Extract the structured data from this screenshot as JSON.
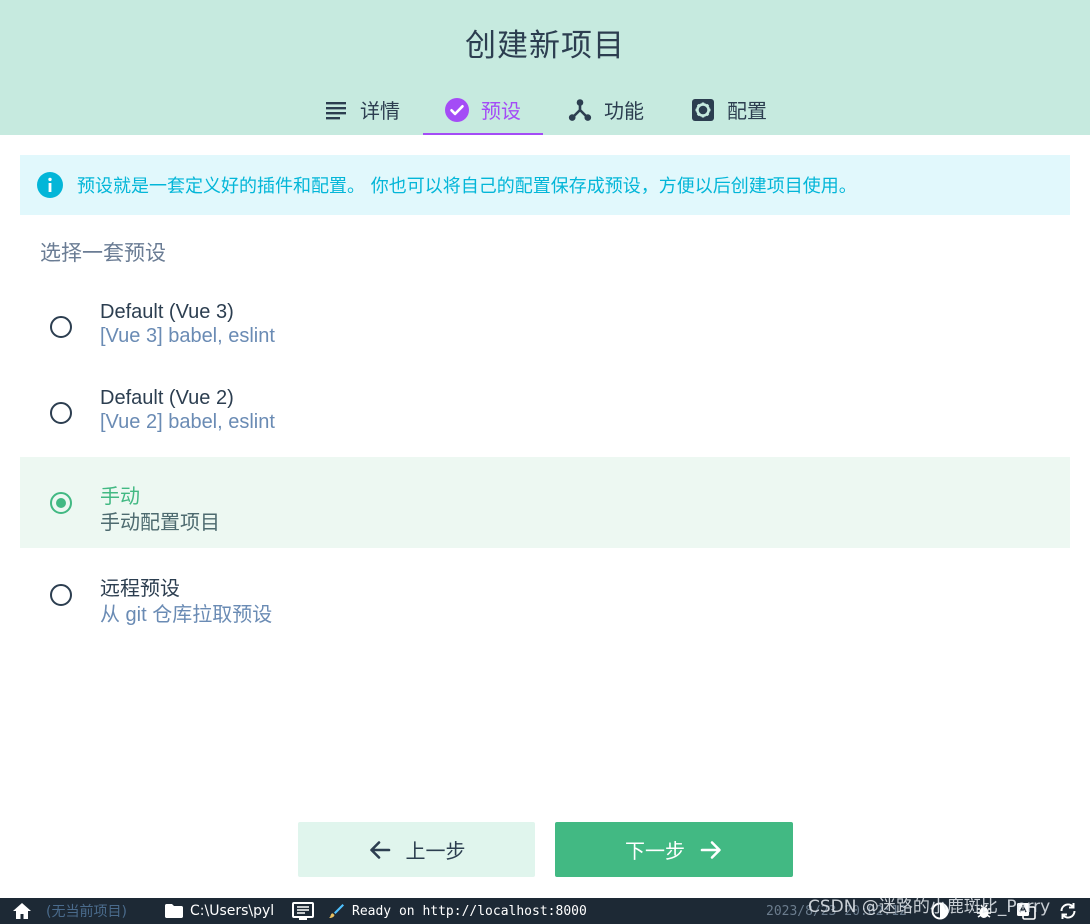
{
  "header": {
    "title": "创建新项目",
    "tabs": [
      {
        "label": "详情",
        "icon": "list-icon",
        "active": false
      },
      {
        "label": "预设",
        "icon": "check-circle-icon",
        "active": true
      },
      {
        "label": "功能",
        "icon": "fork-icon",
        "active": false
      },
      {
        "label": "配置",
        "icon": "gear-icon",
        "active": false
      }
    ]
  },
  "info": {
    "icon": "info-icon",
    "text": "预设就是一套定义好的插件和配置。 你也可以将自己的配置保存成预设，方便以后创建项目使用。"
  },
  "presets": {
    "section_title": "选择一套预设",
    "options": [
      {
        "name": "Default (Vue 3)",
        "desc": "[Vue 3] babel, eslint",
        "selected": false
      },
      {
        "name": "Default (Vue 2)",
        "desc": "[Vue 2] babel, eslint",
        "selected": false
      },
      {
        "name": "手动",
        "desc": "手动配置项目",
        "selected": true
      },
      {
        "name": "远程预设",
        "desc": "从 git 仓库拉取预设",
        "selected": false
      }
    ]
  },
  "actions": {
    "prev_label": "上一步",
    "next_label": "下一步"
  },
  "statusbar": {
    "no_project": "(无当前项目)",
    "path": "C:\\Users\\pyl",
    "log": "Ready on http://localhost:8000",
    "time": "2023/8/23 20:02:12"
  },
  "watermark": "CSDN @迷路的小鹿斑比_Perry",
  "colors": {
    "header_bg": "#c6eadf",
    "accent_purple": "#a44cf6",
    "accent_green": "#42b983",
    "info_bg": "#e1f8fc",
    "info_text": "#03b6d8",
    "statusbar_bg": "#1d2935"
  }
}
